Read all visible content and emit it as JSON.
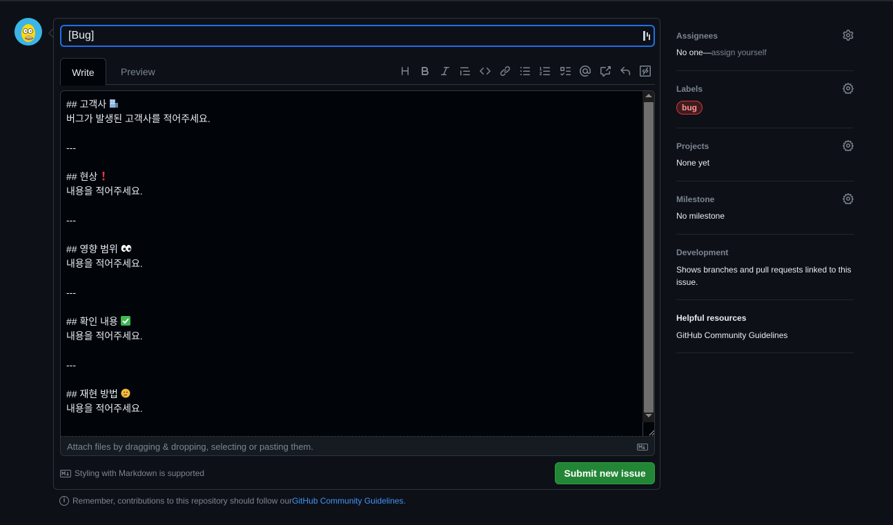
{
  "issue": {
    "title_value": "[Bug]",
    "tabs": [
      {
        "label": "Write",
        "active": true
      },
      {
        "label": "Preview",
        "active": false
      }
    ],
    "toolbar_icons": [
      "heading-icon",
      "bold-icon",
      "italic-icon",
      "quote-icon",
      "code-icon",
      "link-icon",
      "unordered-list-icon",
      "ordered-list-icon",
      "task-list-icon",
      "mention-icon",
      "cross-reference-icon",
      "reply-icon",
      "slash-command-icon"
    ],
    "body_lines": [
      {
        "text": "## 고객사",
        "emoji": "office-building-icon"
      },
      {
        "text": "버그가 발생된 고객사를 적어주세요."
      },
      {
        "text": ""
      },
      {
        "text": "---"
      },
      {
        "text": ""
      },
      {
        "text": "## 현상",
        "emoji": "exclamation-icon"
      },
      {
        "text": "내용을 적어주세요."
      },
      {
        "text": ""
      },
      {
        "text": "---"
      },
      {
        "text": ""
      },
      {
        "text": "## 영향 범위",
        "emoji": "eyes-icon"
      },
      {
        "text": "내용을 적어주세요."
      },
      {
        "text": ""
      },
      {
        "text": "---"
      },
      {
        "text": ""
      },
      {
        "text": "## 확인 내용",
        "emoji": "check-mark-icon"
      },
      {
        "text": "내용을 적어주세요."
      },
      {
        "text": ""
      },
      {
        "text": "---"
      },
      {
        "text": ""
      },
      {
        "text": "## 재현 방법",
        "emoji": "thinking-face-icon"
      },
      {
        "text": "내용을 적어주세요."
      }
    ],
    "attach_hint": "Attach files by dragging & dropping, selecting or pasting them.",
    "markdown_hint": "Styling with Markdown is supported",
    "submit_label": "Submit new issue",
    "remember_prefix": "Remember, contributions to this repository should follow our ",
    "remember_link": "GitHub Community Guidelines",
    "remember_suffix": "."
  },
  "sidebar": {
    "assignees": {
      "heading": "Assignees",
      "value": "No one—",
      "action": "assign yourself"
    },
    "labels": {
      "heading": "Labels",
      "items": [
        "bug"
      ]
    },
    "projects": {
      "heading": "Projects",
      "value": "None yet"
    },
    "milestone": {
      "heading": "Milestone",
      "value": "No milestone"
    },
    "development": {
      "heading": "Development",
      "value": "Shows branches and pull requests linked to this issue."
    },
    "helpful": {
      "heading": "Helpful resources",
      "link": "GitHub Community Guidelines"
    }
  },
  "colors": {
    "background": "#0d1117",
    "accent_blue": "#1f6feb",
    "submit_green": "#238636",
    "label_bug": "#da3633",
    "link": "#4493f8"
  }
}
